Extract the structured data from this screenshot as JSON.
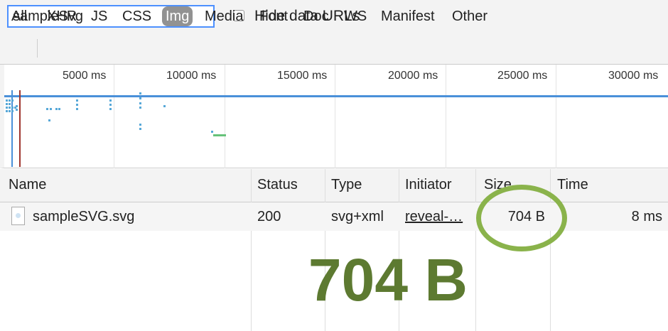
{
  "filter": {
    "value": "sampleSvg",
    "hide_label": "Hide data URLs"
  },
  "types": [
    "All",
    "XHR",
    "JS",
    "CSS",
    "Img",
    "Media",
    "Font",
    "Doc",
    "WS",
    "Manifest",
    "Other"
  ],
  "active_type": "Img",
  "timeline": {
    "ticks": [
      "5000 ms",
      "10000 ms",
      "15000 ms",
      "20000 ms",
      "25000 ms",
      "30000 ms"
    ]
  },
  "table": {
    "headers": [
      "Name",
      "Status",
      "Type",
      "Initiator",
      "Size",
      "Time"
    ],
    "rows": [
      {
        "name": "sampleSVG.svg",
        "status": "200",
        "type": "svg+xml",
        "initiator": "reveal-…",
        "size": "704 B",
        "time": "8 ms"
      }
    ]
  },
  "annotation": {
    "text": "704 B",
    "color": "#5d7a31",
    "circle_color": "#8ab34b"
  },
  "icons": {
    "file": "svg-file-icon"
  }
}
